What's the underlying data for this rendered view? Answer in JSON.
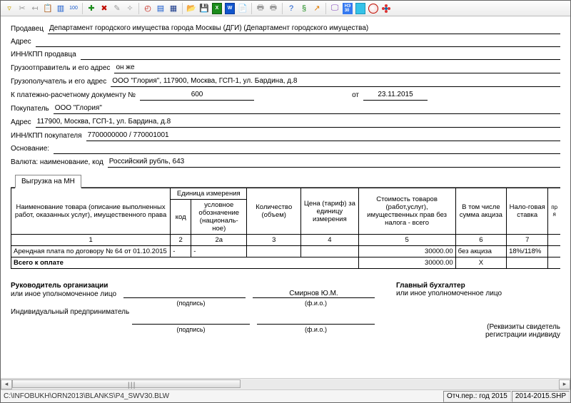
{
  "toolbar": {
    "icons": [
      "funnel-icon",
      "scissors-icon",
      "align-left-icon",
      "paste-icon",
      "columns-icon",
      "zoom-icon",
      "sep",
      "plus-icon",
      "delete-icon",
      "pencil-icon",
      "wand-icon",
      "sep",
      "pdf-icon",
      "letter-icon",
      "calculator-icon",
      "sep",
      "open-icon",
      "save-icon",
      "xls-icon",
      "word-icon",
      "report-icon",
      "sep",
      "print-icon",
      "print-all-icon",
      "sep",
      "help-icon",
      "link-icon",
      "arrow-out-icon",
      "sep",
      "monitor-icon",
      "ne-icon",
      "teamviewer-icon",
      "globe-icon",
      "flower-icon"
    ]
  },
  "form": {
    "seller_label": "Продавец",
    "seller_value": "Департамент городского имущества города Москвы (ДГИ)   (Департамент городского имущества)",
    "address_label": "Адрес",
    "address_value": "",
    "inn_seller_label": "ИНН/КПП продавца",
    "inn_seller_value": "",
    "consignor_label": "Грузоотправитель и его адрес",
    "consignor_value": "он же",
    "consignee_label": "Грузополучатель и его адрес",
    "consignee_value": "ООО \"Глория\", 117900, Москва, ГСП-1, ул. Бардина, д.8",
    "paydoc_label": "К платежно-расчетному документу №",
    "paydoc_num": "600",
    "paydoc_ot": "от",
    "paydoc_date": "23.11.2015",
    "buyer_label": "Покупатель",
    "buyer_value": "ООО \"Глория\"",
    "buyer_addr_label": "Адрес",
    "buyer_addr_value": "117900, Москва, ГСП-1, ул. Бардина, д.8",
    "inn_buyer_label": "ИНН/КПП покупателя",
    "inn_buyer_value": "7700000000 / 770001001",
    "basis_label": "Основание:",
    "basis_value": "",
    "currency_label": "Валюта: наименование, код",
    "currency_value": "Российский рубль, 643"
  },
  "tab_label": "Выгрузка на МН",
  "table": {
    "headers": {
      "name": "Наименование товара (описание выполненных работ, оказанных услуг), имущественного права",
      "unit": "Единица измерения",
      "code": "код",
      "symbol": "условное обозначение (националь-ное)",
      "qty": "Количество (объем)",
      "price": "Цена (тариф) за единицу измерения",
      "cost": "Стоимость товаров (работ,услуг), имущественных прав без налога - всего",
      "excise": "В том числе сумма акциза",
      "rate": "Нало-говая ставка",
      "edge": "пр я"
    },
    "col_nums": [
      "1",
      "2",
      "2а",
      "3",
      "4",
      "5",
      "6",
      "7"
    ],
    "row": {
      "name": "Арендная плата по договору № 64 от 01.10.2015",
      "code": "-",
      "symbol": "-",
      "qty": "",
      "price": "",
      "cost": "30000.00",
      "excise": "без акциза",
      "rate": "18%/118%"
    },
    "total_label": "Всего к оплате",
    "total_cost": "30000.00",
    "total_excise": "X"
  },
  "signatures": {
    "head_label": "Руководитель организации",
    "or_person": "или иное уполномоченное лицо",
    "name": "Смирнов Ю.М.",
    "caption_sign": "(подпись)",
    "caption_fio": "(ф.и.о.)",
    "ip_label": "Индивидуальный предприниматель",
    "chief_acc": "Главный бухгалтер",
    "rekv1": "(Реквизиты свидетель",
    "rekv2": "регистрации индивиду"
  },
  "status": {
    "path": "C:\\INFOBUKH\\ORN2013\\BLANKS\\P4_SWV30.BLW",
    "period": "Отч.пер.: год 2015",
    "file": "2014-2015.SHP"
  }
}
